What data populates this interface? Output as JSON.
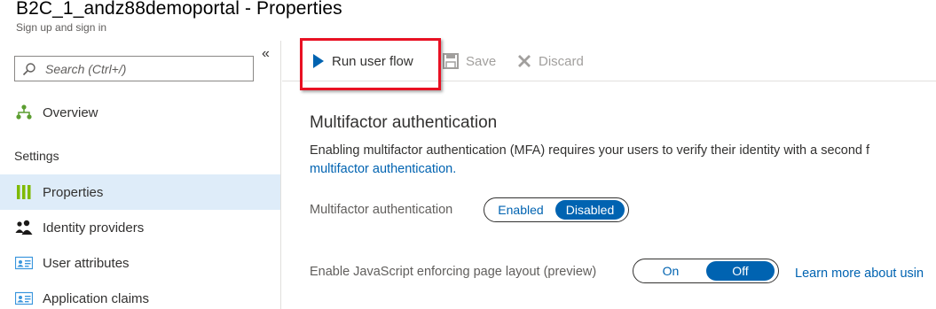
{
  "header": {
    "title": "B2C_1_andz88demoportal - Properties",
    "subtitle": "Sign up and sign in"
  },
  "sidebar": {
    "search_placeholder": "Search (Ctrl+/)",
    "collapse_label": "«",
    "overview_label": "Overview",
    "section_settings": "Settings",
    "items": [
      {
        "label": "Properties",
        "icon": "properties-icon",
        "active": true
      },
      {
        "label": "Identity providers",
        "icon": "users-icon",
        "active": false
      },
      {
        "label": "User attributes",
        "icon": "contact-card-icon",
        "active": false
      },
      {
        "label": "Application claims",
        "icon": "contact-card-icon",
        "active": false
      }
    ]
  },
  "toolbar": {
    "run_label": "Run user flow",
    "save_label": "Save",
    "discard_label": "Discard"
  },
  "main": {
    "heading": "Multifactor authentication",
    "description": "Enabling multifactor authentication (MFA) requires your users to verify their identity with a second f",
    "link": "multifactor authentication.",
    "mfa": {
      "label": "Multifactor authentication",
      "options": [
        "Enabled",
        "Disabled"
      ],
      "selected": "Disabled"
    },
    "js": {
      "label": "Enable JavaScript enforcing page layout (preview)",
      "options": [
        "On",
        "Off"
      ],
      "selected": "Off",
      "learn_more": "Learn more about usin"
    }
  },
  "colors": {
    "accent": "#0063b1",
    "highlight": "#e81123",
    "active_nav": "#deecf9"
  }
}
